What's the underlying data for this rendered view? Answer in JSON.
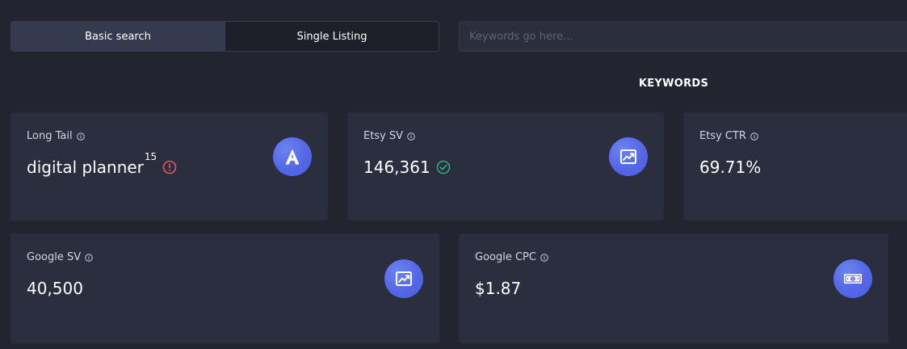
{
  "search": {
    "modes": [
      {
        "label": "Basic search",
        "active": true
      },
      {
        "label": "Single Listing",
        "active": false
      }
    ],
    "placeholder": "Keywords go here..."
  },
  "section": {
    "title": "KEYWORDS"
  },
  "metrics": {
    "long_tail": {
      "label": "Long Tail",
      "value": "digital planner",
      "superscript": "15",
      "status": "warning",
      "icon": "letter-a-icon"
    },
    "etsy_sv": {
      "label": "Etsy SV",
      "value": "146,361",
      "status": "ok",
      "icon": "trend-chart-icon"
    },
    "etsy_ctr": {
      "label": "Etsy CTR",
      "value": "69.71%"
    },
    "google_sv": {
      "label": "Google SV",
      "value": "40,500",
      "icon": "trend-chart-icon"
    },
    "google_cpc": {
      "label": "Google CPC",
      "value": "$1.87",
      "icon": "banknote-icon"
    }
  },
  "colors": {
    "background": "#22242f",
    "card": "#2b2e3e",
    "accent": "#5467e6",
    "warning": "#e05a5a",
    "ok": "#27b07a"
  }
}
